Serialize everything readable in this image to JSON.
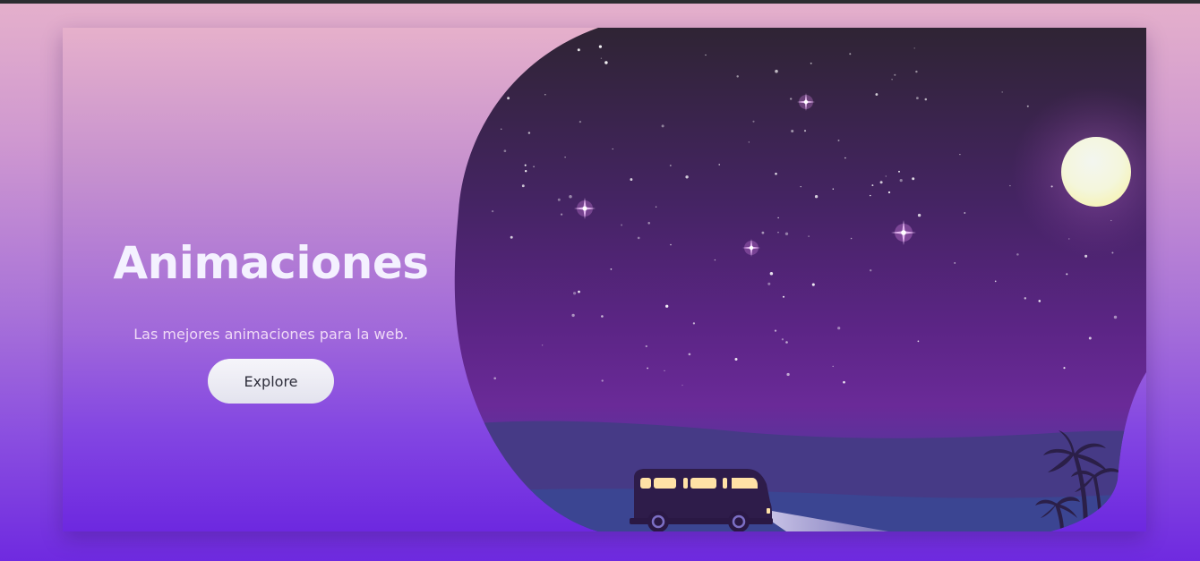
{
  "hero": {
    "title": "Animaciones",
    "subtitle": "Las mejores animaciones para la web.",
    "cta_label": "Explore"
  },
  "scene": {
    "illustration": "night-sky-with-moon-and-van",
    "colors": {
      "sky_top": "#2f2434",
      "sky_bottom": "#6a2a98",
      "hill": "#453a84",
      "road": "#3a4690",
      "moon": "#f4f8e6",
      "van": "#2e1c4a",
      "van_windows": "#ffe2a6"
    }
  }
}
